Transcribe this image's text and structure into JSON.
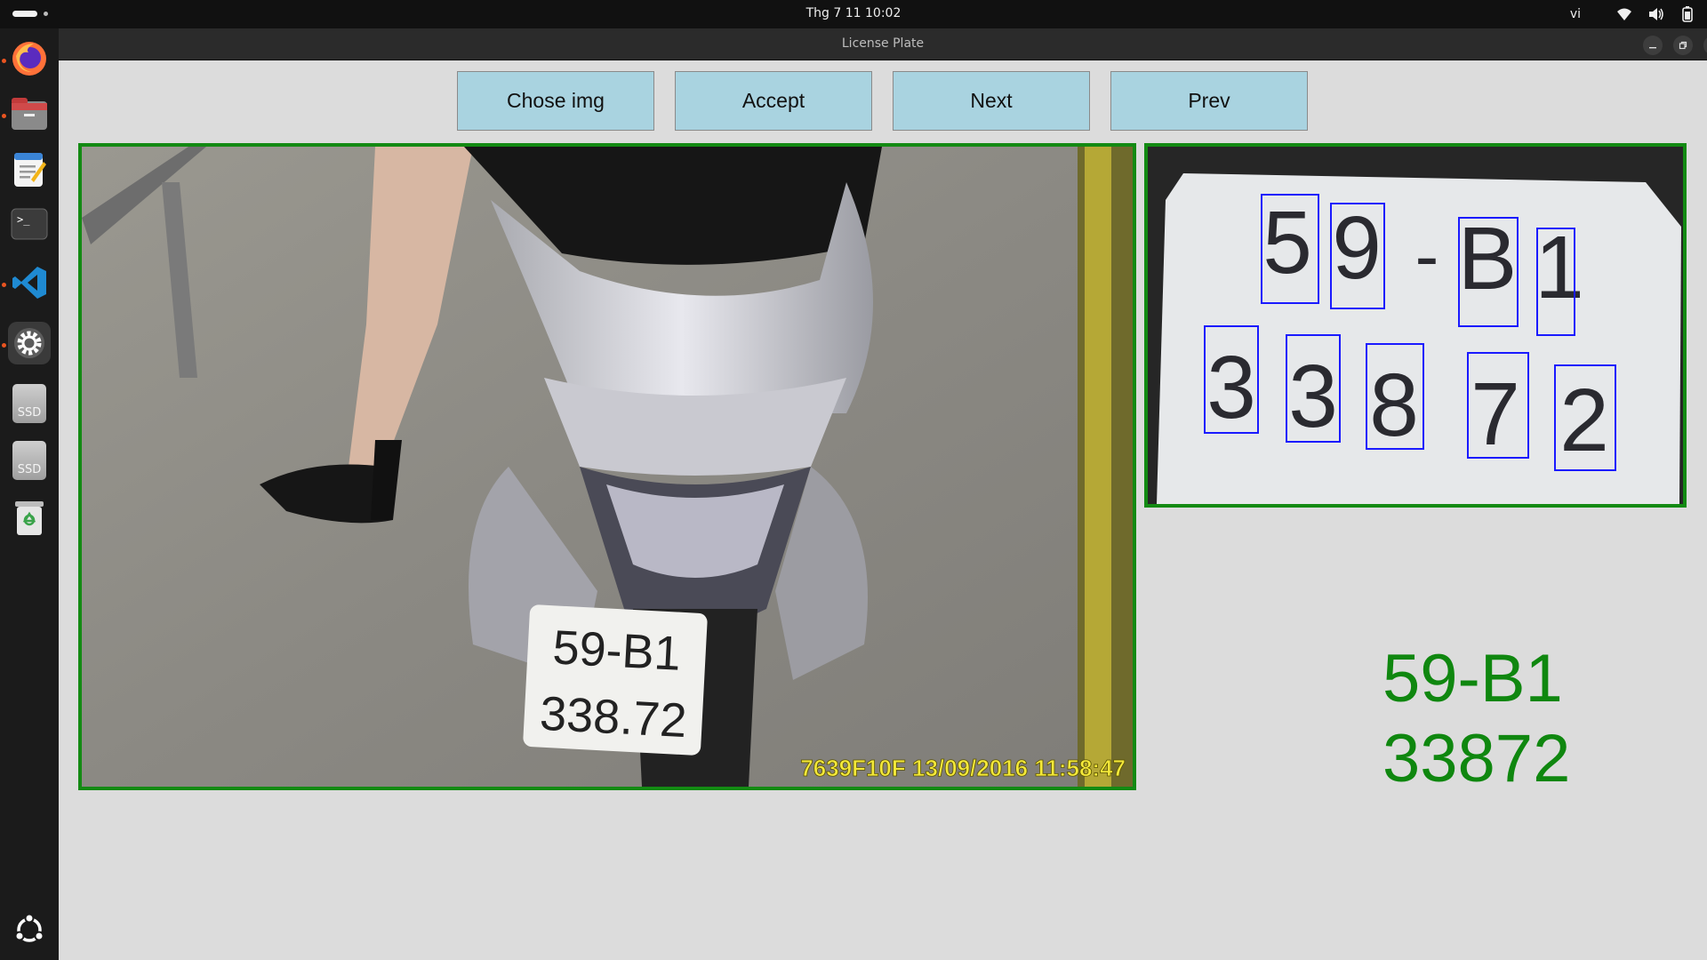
{
  "topbar": {
    "clock": "Thg 7 11  10:02",
    "input_language": "vi",
    "icons": [
      "wifi-icon",
      "volume-icon",
      "battery-icon"
    ]
  },
  "dock": {
    "items": [
      {
        "name": "firefox",
        "running": true
      },
      {
        "name": "files",
        "running": true
      },
      {
        "name": "text-editor",
        "running": false
      },
      {
        "name": "terminal",
        "running": false
      },
      {
        "name": "vscode",
        "running": true
      },
      {
        "name": "settings",
        "running": true,
        "active": true
      },
      {
        "name": "ssd-drive",
        "label": "SSD"
      },
      {
        "name": "ssd-drive",
        "label": "SSD"
      },
      {
        "name": "trash"
      },
      {
        "name": "show-apps"
      }
    ]
  },
  "window": {
    "title": "License Plate"
  },
  "toolbar": {
    "chose_img_label": "Chose img",
    "accept_label": "Accept",
    "next_label": "Next",
    "prev_label": "Prev"
  },
  "photo": {
    "plate_line1": "59-B1",
    "plate_line2": "338.72",
    "camera_overlay": "7639F10F  13/09/2016 11:58:47"
  },
  "segmented_plate": {
    "row1": [
      "5",
      "9",
      "-",
      "B",
      "1"
    ],
    "row2": [
      "3",
      "3",
      "8",
      "7",
      "2"
    ]
  },
  "result": {
    "line1": "59-B1",
    "line2": "33872"
  },
  "colors": {
    "button_bg": "#a9d3e0",
    "frame_green": "#138a13",
    "result_green": "#0f870f",
    "char_box_blue": "#1a1aff",
    "overlay_yellow": "#f4e93a"
  }
}
